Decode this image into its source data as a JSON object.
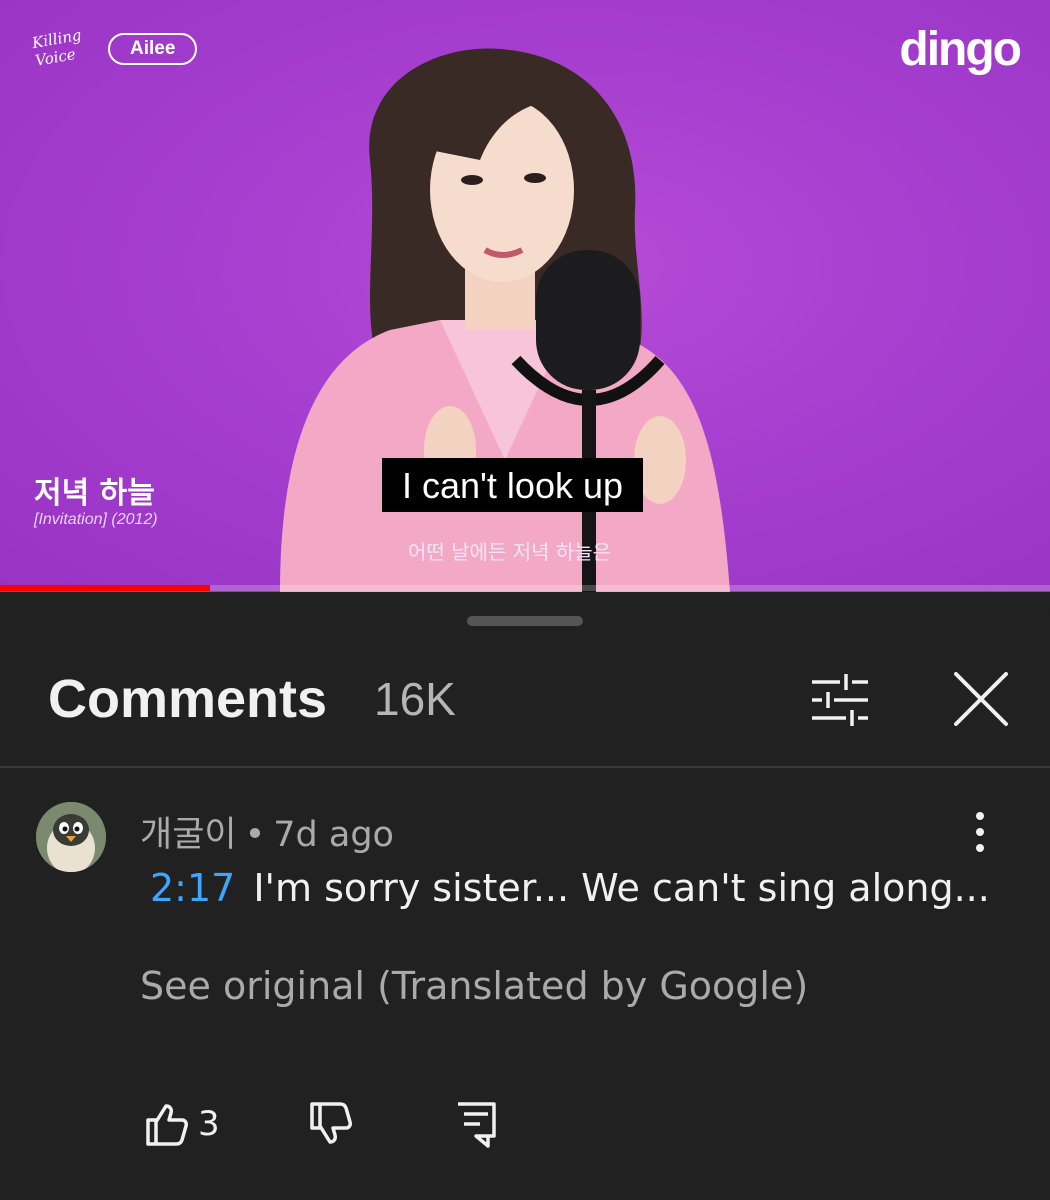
{
  "video": {
    "logo_script": "Killing Voice",
    "logo_artist": "Ailee",
    "channel_logo": "dingo",
    "song_title": "저녁 하늘",
    "song_subtitle": "[Invitation] (2012)",
    "caption": "I can't look up",
    "korean_subtitle": "어떤 날에든 저녁 하늘은",
    "progress_fraction": 0.2,
    "accent_color": "#a63fcf"
  },
  "comments": {
    "title": "Comments",
    "count": "16K",
    "filter_icon": "filter-icon",
    "close_icon": "close-icon",
    "items": [
      {
        "author": "개굴이",
        "separator": "•",
        "time": "7d ago",
        "timestamp": "2:17",
        "text": "I'm sorry sister... We can't sing along...",
        "see_original": "See original (Translated by Google)",
        "likes": "3",
        "timestamp_color": "#3ea6ff"
      }
    ]
  }
}
